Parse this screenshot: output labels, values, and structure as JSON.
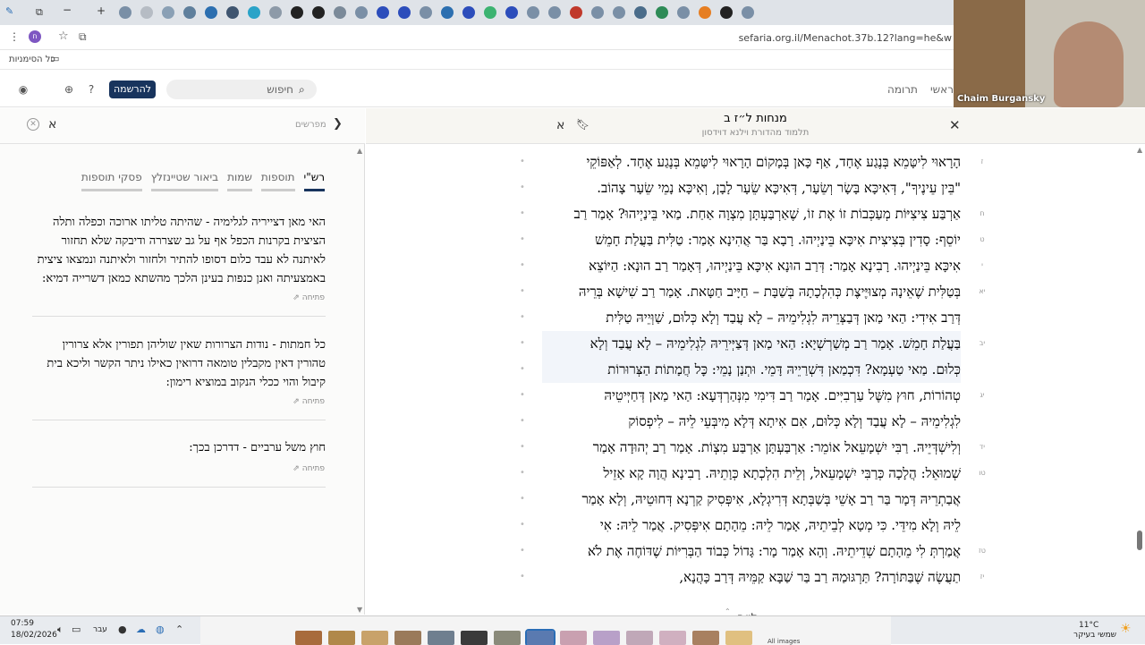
{
  "browser": {
    "url": "sefaria.org.il/Menachot.37b.12?lang=he&w",
    "bookmarks_label": "כל הסימניות",
    "tab_icon_colors": [
      "#7a8fa6",
      "#b6bcc4",
      "#8aa0b5",
      "#5f7f9c",
      "#2c6fb0",
      "#3f5570",
      "#2aa3c8",
      "#8d9aa8",
      "#222",
      "#222",
      "#7b8a99",
      "#7a8fa6",
      "#2c4dbb",
      "#2c4dbb",
      "#7a8fa6",
      "#2c6fb0",
      "#2c4dbb",
      "#3cb371",
      "#2c4dbb",
      "#7a8fa6",
      "#7a8fa6",
      "#c0392b",
      "#7a8fa6",
      "#7a8fa6",
      "#4a6c8a",
      "#2e8b57",
      "#7a8fa6",
      "#e67e22",
      "#222",
      "#7a8fa6"
    ]
  },
  "site_header": {
    "signup_label": "להרשמה",
    "search_placeholder": "חיפוש",
    "nav_donate": "תרומה",
    "nav_home": "ראשי"
  },
  "left_panel": {
    "commentators_label": "מפרשים",
    "alef": "א",
    "tabs": [
      "רש\"י",
      "תוספות",
      "שמות",
      "ביאור שטיינזלץ",
      "פסקי תוספות"
    ],
    "open_label": "פתיחה",
    "comments": [
      "האי מאן דצייריה לגלימיה - שהיתה טליתו ארוכה וכפלה ותלה הציצית בקרנות הכפל אף על גב שצררה ודיבקה שלא תחזור לאיתנה לא עבד כלום דסופו להתיר ולחזור ולאיתנה ונמצאו ציצית באמצעיתה ואנן כנפות בעינן הלכך מהשתא כמאן דשרייה דמיא:",
      "כל חמתות - נודות הצרורות שאין שוליהן תפורין אלא צרורין טהורין דאין מקבלין טומאה דרואין כאילו ניתר הקשר וליכא בית קיבול והוי ככלי הנקוב במוציא רימון:",
      "חוץ משל ערביים - דדרכן בכך:"
    ]
  },
  "main": {
    "title": "מנחות ל״ז ב",
    "subtitle": "תלמוד מהדורת וילנא דוידסון",
    "alef": "א",
    "lines": [
      {
        "num": "ז",
        "text": "הָרָאוּי לִיטָּמֵא בְּנֶגַע אֶחָד, אַף כָּאן בְּמָקוֹם הָרָאוּי לִיטָּמֵא בְּנֶגַע אֶחָד. לְאַפּוֹקֵי"
      },
      {
        "num": "",
        "text": "\"בֵּין עֵינֶיךָ\", דְּאִיכָּא בָּשָׂר וְשֵׂעָר, דְּאִיכָּא שֵׂעָר לָבָן, וְאִיכָּא נָמֵי שֵׂעָר צָהוֹב."
      },
      {
        "num": "ח",
        "text": "אַרְבַּע צִיצִיּוֹת מְעַכְּבוֹת זוֹ אֶת זוֹ, שֶׁאַרְבַּעְתָּן מִצְוָה אַחַת. מַאי בֵּינַיְיהוּ? אָמַר רַב"
      },
      {
        "num": "ט",
        "text": "יוֹסֵף: סָדִין בְּצִיצִית אִיכָּא בֵּינַיְיהוּ. רָבָא בַּר אֲהִינָא אָמַר: טַלִּית בַּעֲלַת חָמֵשׁ"
      },
      {
        "num": "י",
        "text": "אִיכָּא בֵּינַיְיהוּ. רָבִינָא אָמַר: דְּרַב הוּנָא אִיכָּא בֵּינַיְיהוּ, דְּאָמַר רַב הוּנָא: הַיּוֹצֵא"
      },
      {
        "num": "יא",
        "text": "בְּטַלִּית שֶׁאֵינָהּ מְצוּיֶּיצֶת כְּהִלְכָתָהּ בְּשַׁבָּת – חַיָּיב חַטָּאת. אָמַר רַב שִׁישָׁא בְּרֵיהּ"
      },
      {
        "num": "",
        "text": "דְּרַב אִידִי: הַאי מַאן דְּבַצְּרֵיהּ לִגְלִימֵיהּ – לָא עֲבַד וְלָא כְּלוּם, שַׁוְּיֵיהּ טַלִּית"
      },
      {
        "num": "יב",
        "text": "בַּעֲלַת חָמֵשׁ. אָמַר רַב מְשַׁרְשְׁיָא: הַאי מַאן דְּצַיְּירֵיהּ לִגְלִימֵיהּ – לָא עֲבַד וְלָא"
      },
      {
        "num": "",
        "text": "כְּלוּם. מַאי טַעְמָא? דִּכְמַאן דִּשְׁרַיֵיהּ דָּמֵי. וּתְנַן נָמֵי: כׇּל חֲמָתוֹת הַצְּרוּרוֹת"
      },
      {
        "num": "יג",
        "text": "טְהוֹרוֹת, חוּץ מִשֶּׁל עַרְבִיִּים. אָמַר רַב דִּימִי מִנְּהַרְדְּעָא: הַאי מַאן דְּחַיְּיטֵיהּ"
      },
      {
        "num": "",
        "text": "לִגְלִימֵיהּ – לָא עֲבַד וְלָא כְּלוּם, אִם אִיתָא דְּלָא מִיבְּעֵי לֵיהּ – לִיפְסוֹק"
      },
      {
        "num": "יד",
        "text": "וְלִישְׁדְּיֵיהּ. רַבִּי יִשְׁמָעֵאל אוֹמֵר: אַרְבַּעְתָּן אַרְבַּע מִצְוֹת. אָמַר רַב יְהוּדָה אָמַר"
      },
      {
        "num": "טו",
        "text": "שְׁמוּאֵל: הֲלָכָה כְּרַבִּי יִשְׁמָעֵאל, וְלֵית הִלְכְתָא כְּוָתֵיהּ. רָבִינָא הֲוָה קָא אָזֵיל"
      },
      {
        "num": "",
        "text": "אֲבַתְרֵיהּ דְּמָר בַּר רַב אָשֵׁי בְּשַׁבְּתָא דְּרִיגְלָא, אִיפְּסִיק קַרְנָא דְּחוּטֵיהּ, וְלָא אָמַר"
      },
      {
        "num": "",
        "text": "לֵיהּ וְלָא מִידֵּי. כִּי מְטָא לְבֵיתֵיהּ, אָמַר לֵיהּ: מֵהָתָם אִיפְּסִיק. אֲמַר לֵיהּ: אִי"
      },
      {
        "num": "טז",
        "text": "אֲמַרְתְּ לִי מֵהָתָם שְׁדֵיתֵיהּ. וְהָא אָמַר מָר: גָּדוֹל כְּבוֹד הַבְּרִיּוֹת שֶׁדּוֹחֶה אֶת לֹא"
      },
      {
        "num": "יז",
        "text": "תַעֲשֶׂה שֶׁבַּתּוֹרָה? תַּרְגּוּמַהּ רַב בַּר שַׁבָּא קַמֵּיהּ דְּרַב כָּהֲנָא,"
      }
    ]
  },
  "video": {
    "name": "Chaim Burgansky"
  },
  "taskbar": {
    "time": "07:59",
    "date": "18/02/2026",
    "lang": "עבר",
    "temp": "11°C",
    "weather": "שמשי בעיקר",
    "all_images": "All images"
  }
}
